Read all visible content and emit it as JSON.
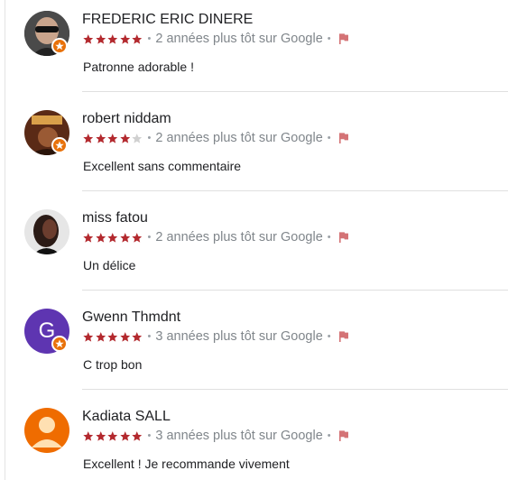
{
  "colors": {
    "star": "#b3292e",
    "star_empty": "#d0d0d0",
    "flag": "#d47376",
    "badge": "#e8710a"
  },
  "reviews": [
    {
      "name": "FREDERIC ERIC DINERE",
      "rating": 5,
      "time": "2 années plus tôt sur Google",
      "text": "Patronne adorable !",
      "avatar": "photo",
      "local_guide": true
    },
    {
      "name": "robert niddam",
      "rating": 4,
      "time": "2 années plus tôt sur Google",
      "text": "Excellent sans commentaire",
      "avatar": "photo",
      "local_guide": true
    },
    {
      "name": "miss fatou",
      "rating": 5,
      "time": "2 années plus tôt sur Google",
      "text": "Un délice",
      "avatar": "photo",
      "local_guide": false
    },
    {
      "name": "Gwenn Thmdnt",
      "rating": 5,
      "time": "3 années plus tôt sur Google",
      "text": "C trop bon",
      "avatar": "initial",
      "initial": "G",
      "avatar_color": "#5e35b1",
      "local_guide": true
    },
    {
      "name": "Kadiata SALL",
      "rating": 5,
      "time": "3 années plus tôt sur Google",
      "text": "Excellent ! Je recommande vivement",
      "avatar": "default-person",
      "avatar_color": "#ef6c00",
      "local_guide": false
    }
  ]
}
